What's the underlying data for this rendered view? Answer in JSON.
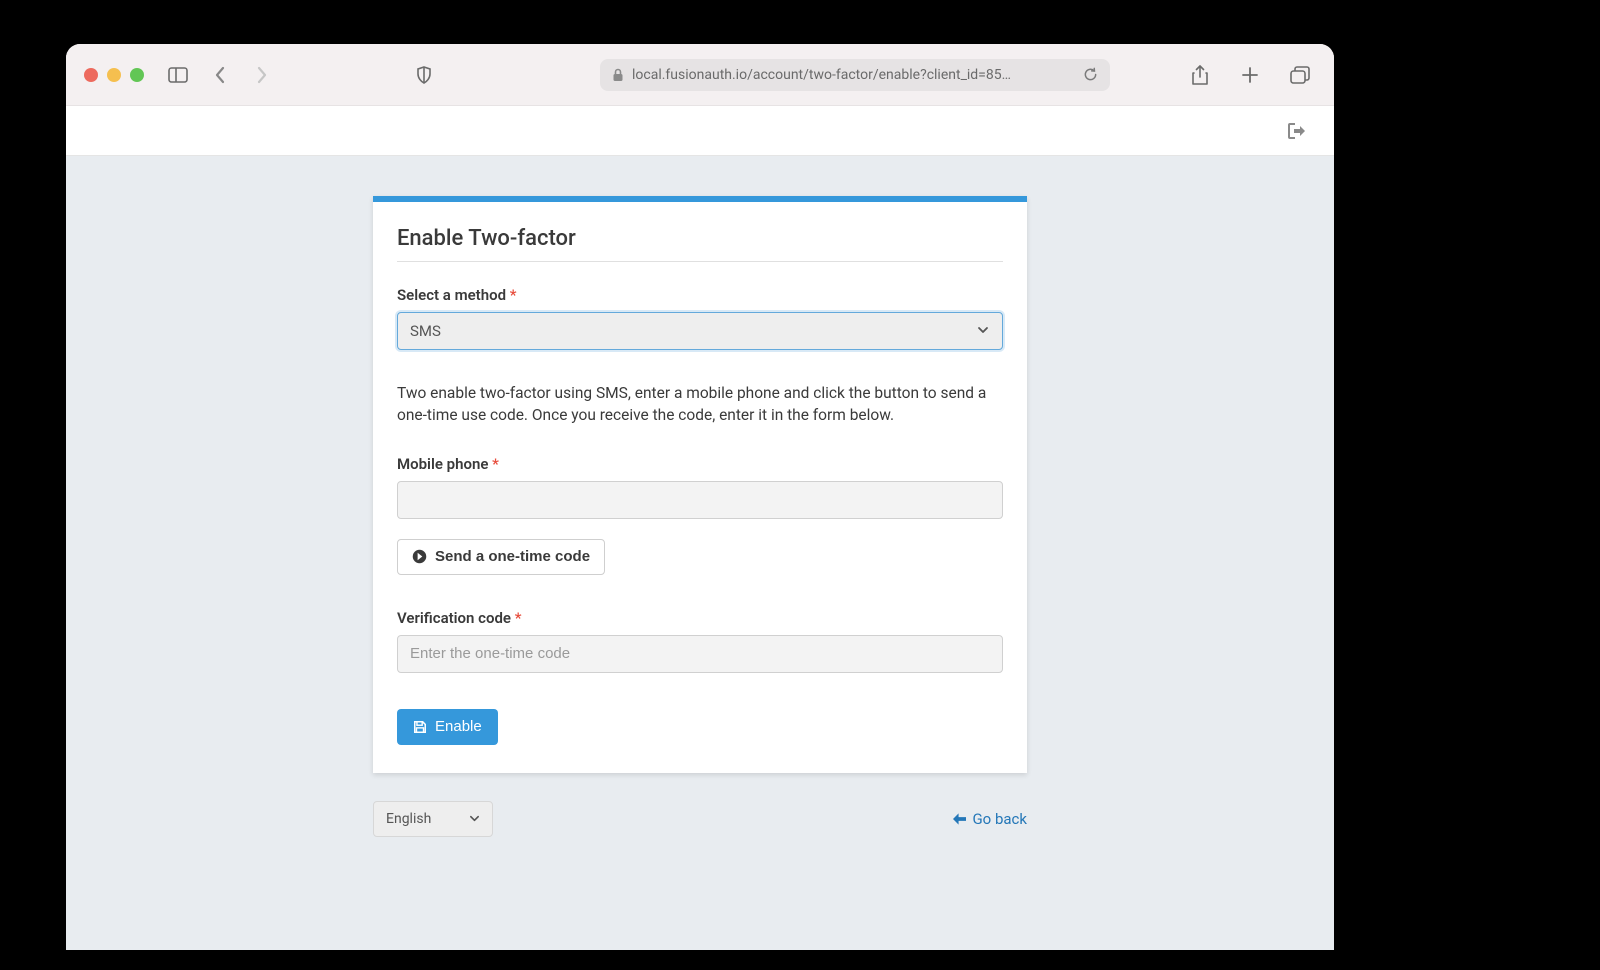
{
  "browser": {
    "url": "local.fusionauth.io/account/two-factor/enable?client_id=85…"
  },
  "page": {
    "title": "Enable Two-factor",
    "method_label": "Select a method",
    "method_selected": "SMS",
    "instructions": "Two enable two-factor using SMS, enter a mobile phone and click the button to send a one-time use code. Once you receive the code, enter it in the form below.",
    "mobile_label": "Mobile phone",
    "mobile_value": "",
    "send_code_label": "Send a one-time code",
    "verification_label": "Verification code",
    "verification_placeholder": "Enter the one-time code",
    "verification_value": "",
    "enable_button": "Enable"
  },
  "footer": {
    "language_selected": "English",
    "go_back": "Go back"
  }
}
